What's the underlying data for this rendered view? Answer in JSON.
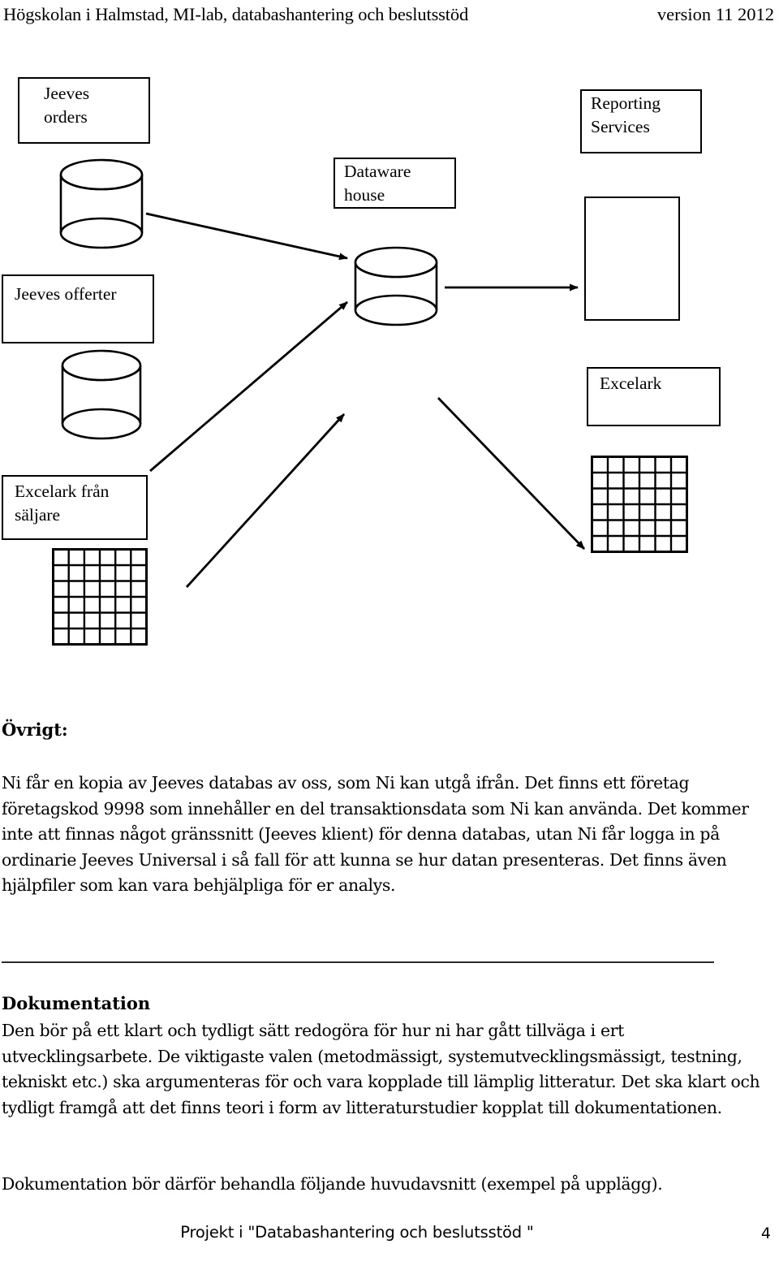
{
  "header": {
    "title": "Högskolan i Halmstad, MI-lab, databashantering och beslutsstöd",
    "version": "version 11 2012"
  },
  "diagram": {
    "boxes": [
      {
        "id": "jeeves-orders",
        "label": "Jeeves\norders"
      },
      {
        "id": "jeeves-offerter",
        "label": "Jeeves offerter"
      },
      {
        "id": "excelark-fran-saljare",
        "label": "Excelark från\nsäljare"
      },
      {
        "id": "dataware-house",
        "label": "Dataware\nhouse"
      },
      {
        "id": "reporting-services",
        "label": "Reporting\nServices"
      },
      {
        "id": "report-output",
        "label": ""
      },
      {
        "id": "excelark",
        "label": "Excelark"
      }
    ],
    "cylinders": [
      {
        "id": "jeeves-orders-db"
      },
      {
        "id": "jeeves-offerter-db"
      },
      {
        "id": "dataware-house-db"
      }
    ],
    "grids": [
      {
        "id": "excelark-fran-saljare-sheet",
        "rows": 6,
        "cols": 6
      },
      {
        "id": "excelark-sheet",
        "rows": 6,
        "cols": 6
      }
    ],
    "arrows": [
      {
        "from": "jeeves-orders-db",
        "to": "dataware-house-db"
      },
      {
        "from": "jeeves-offerter-db",
        "to": "dataware-house-db"
      },
      {
        "from": "excelark-fran-saljare-sheet",
        "to": "dataware-house-db"
      },
      {
        "from": "dataware-house-db",
        "to": "report-output"
      },
      {
        "from": "dataware-house-db",
        "to": "excelark-sheet"
      }
    ],
    "stroke_color": "#000000"
  },
  "content": {
    "ovrigt_heading": "Övrigt:",
    "ovrigt_paragraph": "Ni får en kopia av Jeeves databas av oss, som Ni kan utgå ifrån. Det finns ett företag företagskod 9998 som innehåller en del transaktionsdata som Ni kan använda. Det kommer inte att finnas något gränssnitt (Jeeves klient) för denna databas, utan Ni får logga in på ordinarie Jeeves Universal i så fall för att kunna se hur datan presenteras. Det finns även hjälpfiler som kan vara behjälpliga för er analys.",
    "dokumentation_heading": "Dokumentation",
    "dokumentation_paragraph": "Den bör på ett klart och tydligt sätt redogöra för hur ni har gått tillväga i ert utvecklingsarbete. De viktigaste valen (metodmässigt, systemutvecklingsmässigt, testning, tekniskt etc.) ska argumenteras för och vara kopplade till lämplig litteratur. Det ska klart och tydligt framgå att det finns teori i form av litteraturstudier kopplat till dokumentationen.",
    "closing_paragraph": "Dokumentation bör därför behandla följande huvudavsnitt (exempel på upplägg)."
  },
  "footer": {
    "title": "Projekt i \"Databashantering och beslutsstöd \"",
    "page_number": "4"
  }
}
